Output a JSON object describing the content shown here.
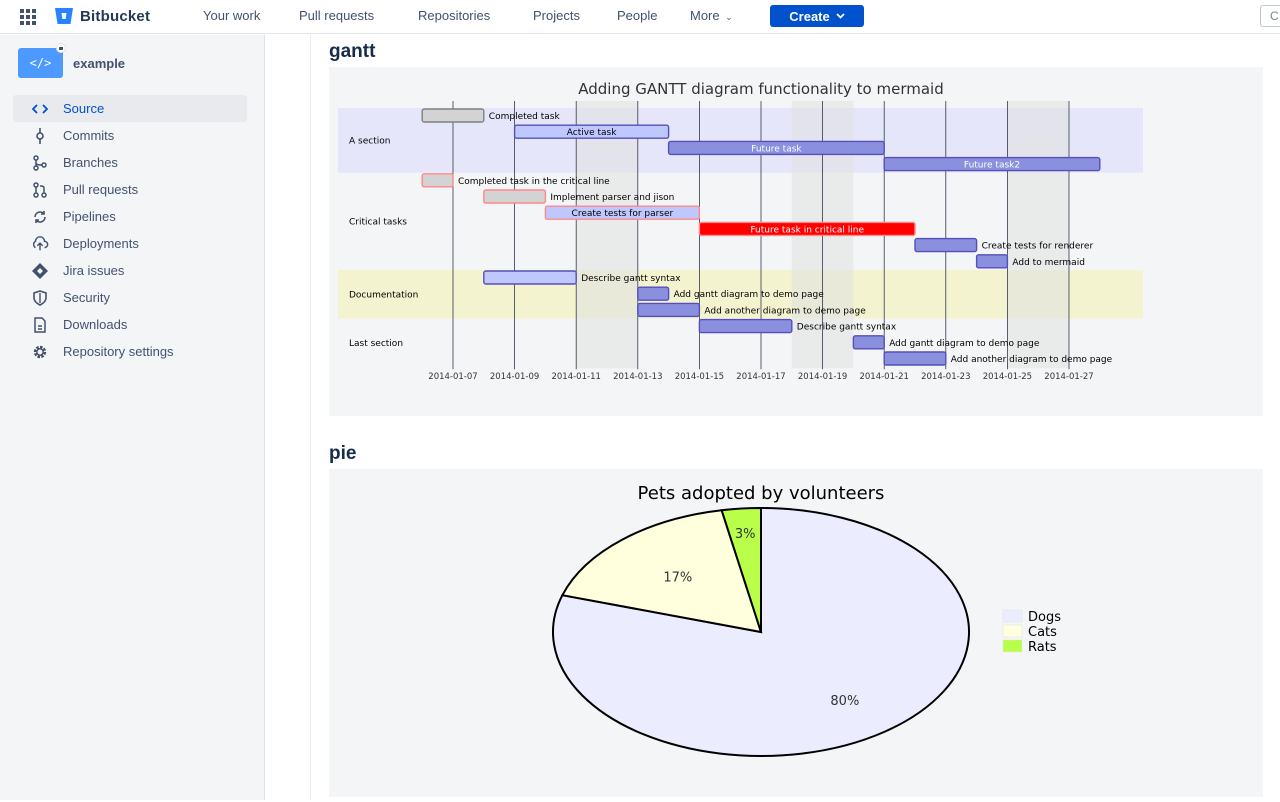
{
  "topnav": {
    "brand": "Bitbucket",
    "items": [
      "Your work",
      "Pull requests",
      "Repositories",
      "Projects",
      "People",
      "More"
    ],
    "create_label": "Create",
    "search_stub": "C"
  },
  "sidebar": {
    "repo_name": "example",
    "repo_avatar_glyph": "</>",
    "items": [
      {
        "label": "Source",
        "icon": "code-icon",
        "active": true
      },
      {
        "label": "Commits",
        "icon": "commit-icon"
      },
      {
        "label": "Branches",
        "icon": "branch-icon"
      },
      {
        "label": "Pull requests",
        "icon": "pull-request-icon"
      },
      {
        "label": "Pipelines",
        "icon": "pipelines-icon"
      },
      {
        "label": "Deployments",
        "icon": "deployments-icon"
      },
      {
        "label": "Jira issues",
        "icon": "jira-icon"
      },
      {
        "label": "Security",
        "icon": "shield-icon"
      },
      {
        "label": "Downloads",
        "icon": "downloads-icon"
      },
      {
        "label": "Repository settings",
        "icon": "gear-icon"
      }
    ]
  },
  "gantt_heading": "gantt",
  "pie_heading": "pie",
  "chart_data": [
    {
      "type": "gantt",
      "title": "Adding GANTT diagram functionality to mermaid",
      "x_ticks": [
        "2014-01-07",
        "2014-01-09",
        "2014-01-11",
        "2014-01-13",
        "2014-01-15",
        "2014-01-17",
        "2014-01-19",
        "2014-01-21",
        "2014-01-23",
        "2014-01-25",
        "2014-01-27"
      ],
      "sections": [
        {
          "name": "A section",
          "tasks": [
            {
              "label": "Completed task",
              "start": "2014-01-06",
              "end": "2014-01-08",
              "status": "done"
            },
            {
              "label": "Active task",
              "start": "2014-01-09",
              "end": "2014-01-14",
              "status": "active"
            },
            {
              "label": "Future task",
              "start": "2014-01-14",
              "end": "2014-01-21",
              "status": "future"
            },
            {
              "label": "Future task2",
              "start": "2014-01-21",
              "end": "2014-01-28",
              "status": "future"
            }
          ]
        },
        {
          "name": "Critical tasks",
          "tasks": [
            {
              "label": "Completed task in the critical line",
              "start": "2014-01-06",
              "end": "2014-01-07",
              "status": "crit-done"
            },
            {
              "label": "Implement parser and jison",
              "start": "2014-01-08",
              "end": "2014-01-10",
              "status": "crit-done"
            },
            {
              "label": "Create tests for parser",
              "start": "2014-01-10",
              "end": "2014-01-15",
              "status": "crit-active"
            },
            {
              "label": "Future task in critical line",
              "start": "2014-01-15",
              "end": "2014-01-22",
              "status": "crit"
            },
            {
              "label": "Create tests for renderer",
              "start": "2014-01-22",
              "end": "2014-01-24",
              "status": "future"
            },
            {
              "label": "Add to mermaid",
              "start": "2014-01-24",
              "end": "2014-01-25",
              "status": "future"
            }
          ]
        },
        {
          "name": "Documentation",
          "tasks": [
            {
              "label": "Describe gantt syntax",
              "start": "2014-01-08",
              "end": "2014-01-11",
              "status": "active"
            },
            {
              "label": "Add gantt diagram to demo page",
              "start": "2014-01-13",
              "end": "2014-01-14",
              "status": "future"
            },
            {
              "label": "Add another diagram to demo page",
              "start": "2014-01-13",
              "end": "2014-01-15",
              "status": "future"
            }
          ]
        },
        {
          "name": "Last section",
          "tasks": [
            {
              "label": "Describe gantt syntax",
              "start": "2014-01-15",
              "end": "2014-01-18",
              "status": "future"
            },
            {
              "label": "Add gantt diagram to demo page",
              "start": "2014-01-20",
              "end": "2014-01-21",
              "status": "future"
            },
            {
              "label": "Add another diagram to demo page",
              "start": "2014-01-21",
              "end": "2014-01-23",
              "status": "future"
            }
          ]
        }
      ]
    },
    {
      "type": "pie",
      "title": "Pets adopted by volunteers",
      "slices": [
        {
          "label": "Dogs",
          "value": 79,
          "color": "#ececff"
        },
        {
          "label": "Cats",
          "value": 17,
          "color": "#ffffde"
        },
        {
          "label": "Rats",
          "value": 3,
          "color": "#b9ff4a"
        }
      ],
      "legend": "right"
    }
  ]
}
